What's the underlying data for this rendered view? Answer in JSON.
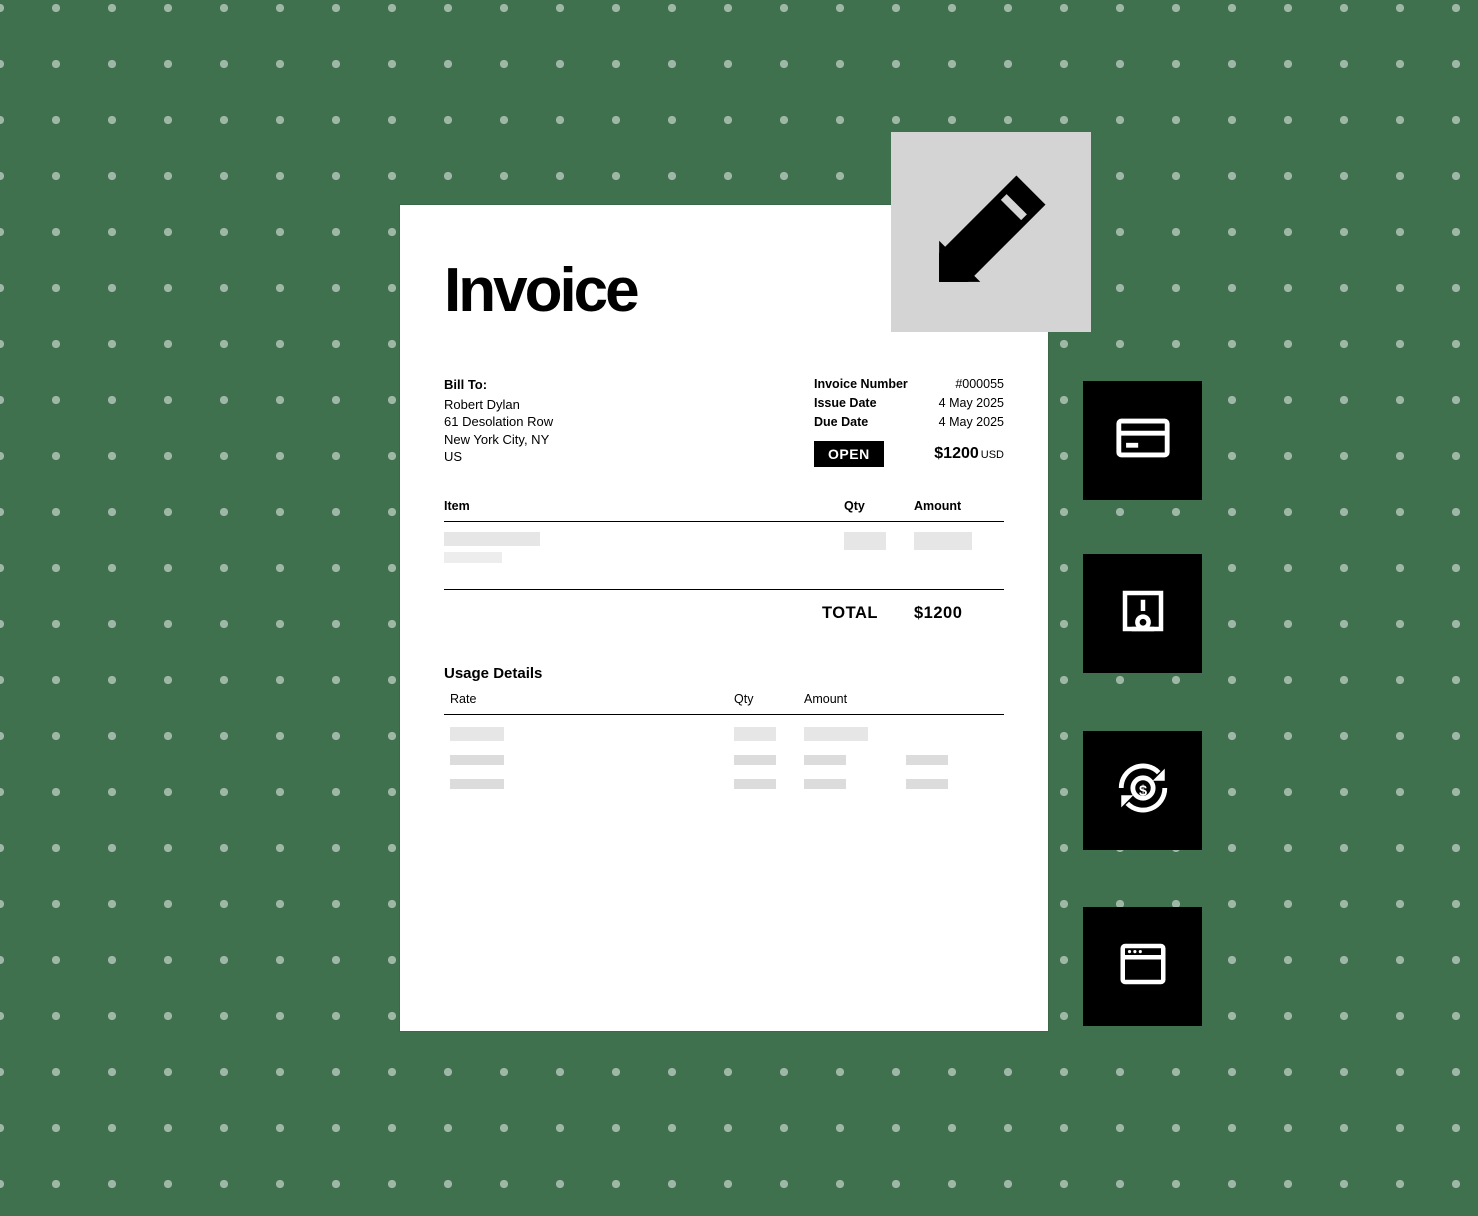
{
  "invoice": {
    "title": "Invoice",
    "bill_to": {
      "label": "Bill To:",
      "name": "Robert Dylan",
      "address1": "61 Desolation Row",
      "address2": "New York City, NY",
      "country": "US"
    },
    "meta": {
      "number_label": "Invoice Number",
      "number": "#000055",
      "issue_label": "Issue Date",
      "issue_date": "4 May 2025",
      "due_label": "Due Date",
      "due_date": "4 May 2025"
    },
    "status": "OPEN",
    "amount_due": "$1200",
    "currency": "USD",
    "items": {
      "header_item": "Item",
      "header_qty": "Qty",
      "header_amount": "Amount",
      "total_label": "TOTAL",
      "total_value": "$1200"
    },
    "usage": {
      "title": "Usage Details",
      "header_rate": "Rate",
      "header_qty": "Qty",
      "header_amount": "Amount"
    }
  },
  "tiles": {
    "edit": "edit-icon",
    "card": "credit-card-icon",
    "bank": "bank-building-icon",
    "refresh_money": "currency-sync-icon",
    "browser": "application-window-icon"
  }
}
